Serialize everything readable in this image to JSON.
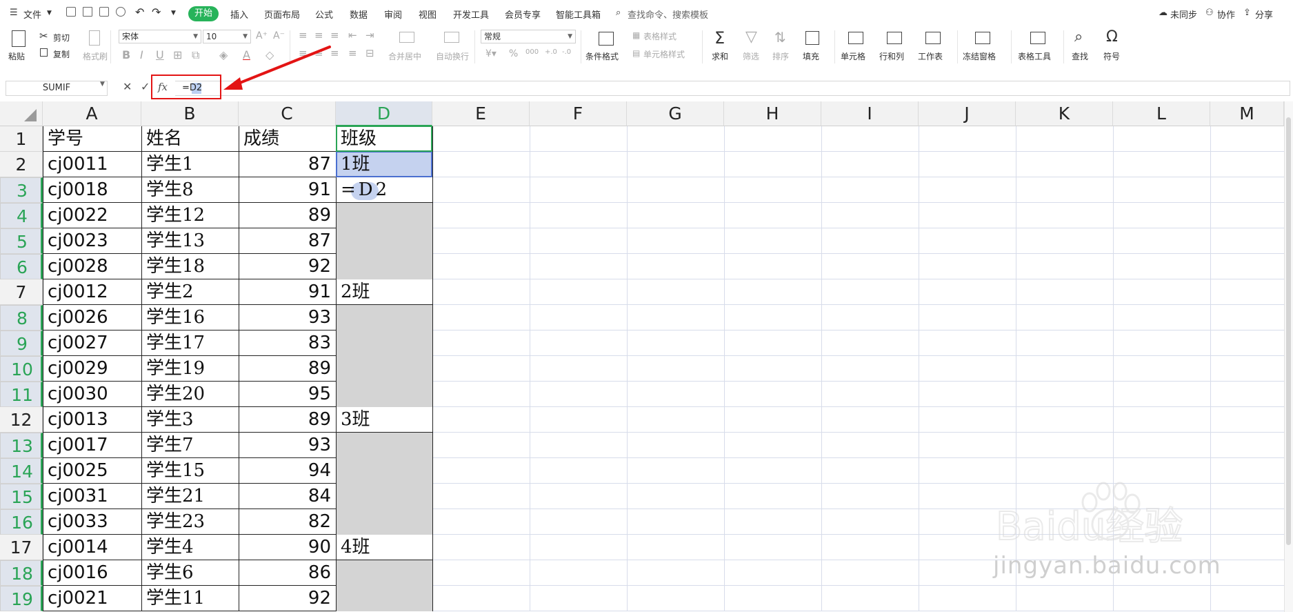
{
  "menubar": {
    "file": "文件",
    "tabs": [
      "开始",
      "插入",
      "页面布局",
      "公式",
      "数据",
      "审阅",
      "视图",
      "开发工具",
      "会员专享",
      "智能工具箱"
    ],
    "search_placeholder": "查找命令、搜索模板",
    "sync": "未同步",
    "collab": "协作",
    "share": "分享"
  },
  "ribbon": {
    "paste": "粘贴",
    "cut": "剪切",
    "copy": "复制",
    "format_painter": "格式刷",
    "font_name": "宋体",
    "font_size": "10",
    "merge_center": "合并居中",
    "wrap_text": "自动换行",
    "number_format": "常规",
    "conditional_format": "条件格式",
    "table_style": "表格样式",
    "cell_style": "单元格样式",
    "sum": "求和",
    "filter": "筛选",
    "sort": "排序",
    "fill": "填充",
    "cell": "单元格",
    "row_col": "行和列",
    "worksheet": "工作表",
    "freeze": "冻结窗格",
    "table_tools": "表格工具",
    "find": "查找",
    "symbol": "符号"
  },
  "formula_bar": {
    "name_box": "SUMIF",
    "fx": "fx",
    "formula": "=D2"
  },
  "sheet": {
    "columns": [
      "A",
      "B",
      "C",
      "D",
      "E",
      "F",
      "G",
      "H",
      "I",
      "J",
      "K",
      "L",
      "M"
    ],
    "active_column": "D",
    "rows": [
      {
        "n": "1",
        "a": "学号",
        "b": "姓名",
        "c": "成绩",
        "d": "班级"
      },
      {
        "n": "2",
        "a": "cj0011",
        "b": "学生1",
        "c": "87",
        "d": "1班"
      },
      {
        "n": "3",
        "a": "cj0018",
        "b": "学生8",
        "c": "91",
        "d": "=D2"
      },
      {
        "n": "4",
        "a": "cj0022",
        "b": "学生12",
        "c": "89",
        "d": ""
      },
      {
        "n": "5",
        "a": "cj0023",
        "b": "学生13",
        "c": "87",
        "d": ""
      },
      {
        "n": "6",
        "a": "cj0028",
        "b": "学生18",
        "c": "92",
        "d": ""
      },
      {
        "n": "7",
        "a": "cj0012",
        "b": "学生2",
        "c": "91",
        "d": "2班"
      },
      {
        "n": "8",
        "a": "cj0026",
        "b": "学生16",
        "c": "93",
        "d": ""
      },
      {
        "n": "9",
        "a": "cj0027",
        "b": "学生17",
        "c": "83",
        "d": ""
      },
      {
        "n": "10",
        "a": "cj0029",
        "b": "学生19",
        "c": "89",
        "d": ""
      },
      {
        "n": "11",
        "a": "cj0030",
        "b": "学生20",
        "c": "95",
        "d": ""
      },
      {
        "n": "12",
        "a": "cj0013",
        "b": "学生3",
        "c": "89",
        "d": "3班"
      },
      {
        "n": "13",
        "a": "cj0017",
        "b": "学生7",
        "c": "93",
        "d": ""
      },
      {
        "n": "14",
        "a": "cj0025",
        "b": "学生15",
        "c": "94",
        "d": ""
      },
      {
        "n": "15",
        "a": "cj0031",
        "b": "学生21",
        "c": "84",
        "d": ""
      },
      {
        "n": "16",
        "a": "cj0033",
        "b": "学生23",
        "c": "82",
        "d": ""
      },
      {
        "n": "17",
        "a": "cj0014",
        "b": "学生4",
        "c": "90",
        "d": "4班"
      },
      {
        "n": "18",
        "a": "cj0016",
        "b": "学生6",
        "c": "86",
        "d": ""
      },
      {
        "n": "19",
        "a": "cj0021",
        "b": "学生11",
        "c": "92",
        "d": ""
      }
    ]
  },
  "watermark": {
    "brand": "Baidu经验",
    "url": "jingyan.baidu.com"
  },
  "colors": {
    "accent_green": "#27b35a",
    "annotation_red": "#e31414",
    "selection_blue": "#c5d2ef",
    "blank_grey": "#d4d4d4"
  }
}
